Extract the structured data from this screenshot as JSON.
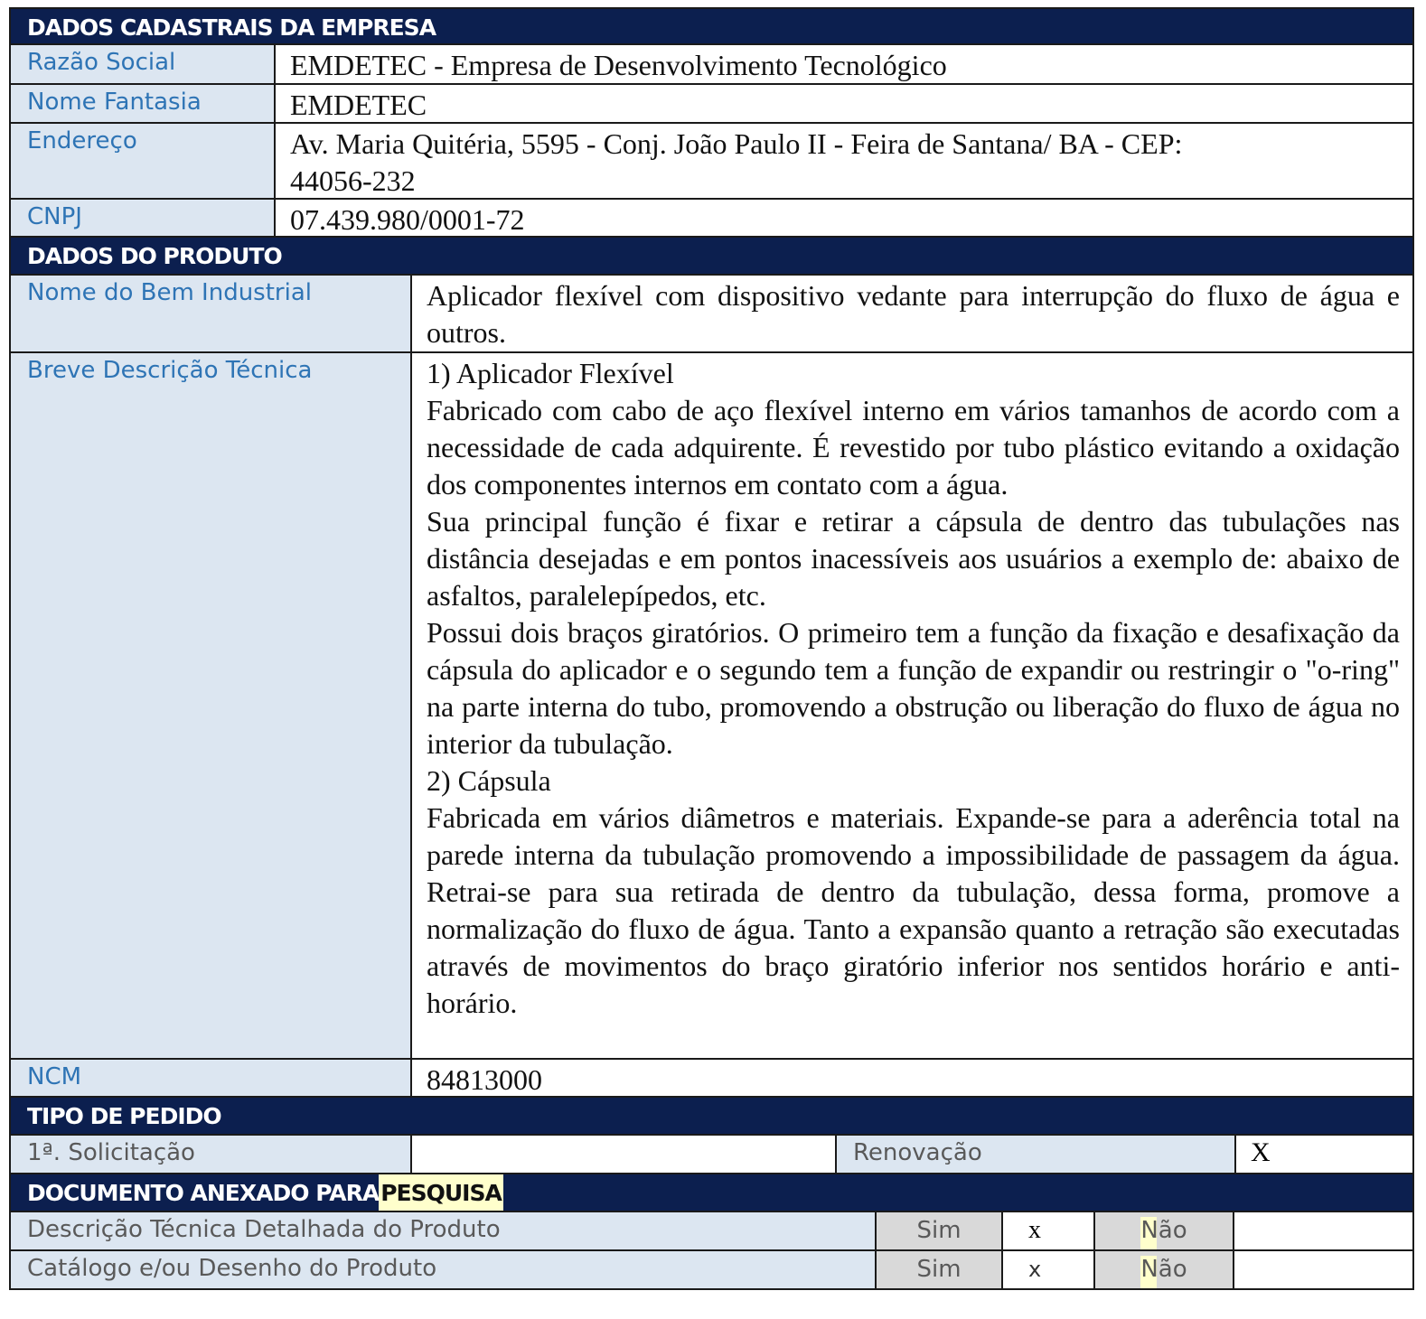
{
  "empresa": {
    "header": "DADOS CADASTRAIS DA EMPRESA",
    "razao_label": "Razão Social",
    "razao_value": "EMDETEC - Empresa de Desenvolvimento Tecnológico",
    "fantasia_label": "Nome Fantasia",
    "fantasia_value": "EMDETEC",
    "endereco_label": "Endereço",
    "endereco_line1": "Av. Maria Quitéria, 5595 - Conj. João Paulo II - Feira de Santana/ BA - CEP:",
    "endereco_line2": "44056-232",
    "cnpj_label": "CNPJ",
    "cnpj_value": "07.439.980/0001-72"
  },
  "produto": {
    "header": "DADOS DO PRODUTO",
    "nome_label": "Nome do Bem Industrial",
    "nome_value": "Aplicador flexível com dispositivo vedante para interrupção do fluxo de água e outros.",
    "descricao_label": "Breve Descrição Técnica",
    "descricao_paragraphs": [
      "1) Aplicador Flexível",
      "Fabricado com cabo de aço flexível interno em vários tamanhos de acordo com a necessidade de cada adquirente. É revestido por tubo plástico evitando a oxidação dos componentes internos em contato com a água.",
      "Sua principal função é fixar e retirar a cápsula de dentro das tubulações nas distância desejadas e em pontos inacessíveis aos usuários a exemplo de: abaixo de asfaltos, paralelepípedos, etc.",
      "Possui dois braços giratórios. O primeiro tem a função da fixação e desafixação da cápsula do aplicador e o segundo tem a função de expandir ou restringir o \"o-ring\" na parte interna do tubo, promovendo a obstrução ou liberação do fluxo de água no interior da tubulação.",
      "2) Cápsula",
      "Fabricada em vários diâmetros e materiais. Expande-se para a aderência total na parede interna da tubulação promovendo a impossibilidade de passagem da água. Retrai-se para sua retirada de dentro da tubulação, dessa forma, promove a normalização do fluxo de água. Tanto a expansão quanto a retração são executadas através de movimentos do braço giratório inferior nos sentidos horário e anti-horário."
    ],
    "ncm_label": "NCM",
    "ncm_value": "84813000"
  },
  "pedido": {
    "header": "TIPO DE PEDIDO",
    "primeira_label": "1ª. Solicitação",
    "primeira_mark": "",
    "renovacao_label": "Renovação",
    "renovacao_mark": "X"
  },
  "documento": {
    "header_prefix": "DOCUMENTO ANEXADO PARA ",
    "header_highlight": "PESQUISA",
    "rows": [
      {
        "label": "Descrição Técnica Detalhada do Produto",
        "sim_label": "Sim",
        "sim_mark": "x",
        "nao_label": "Não",
        "nao_mark": ""
      },
      {
        "label": "Catálogo e/ou Desenho do Produto",
        "sim_label": "Sim",
        "sim_mark": "x",
        "nao_label": "Não",
        "nao_mark": ""
      }
    ]
  }
}
